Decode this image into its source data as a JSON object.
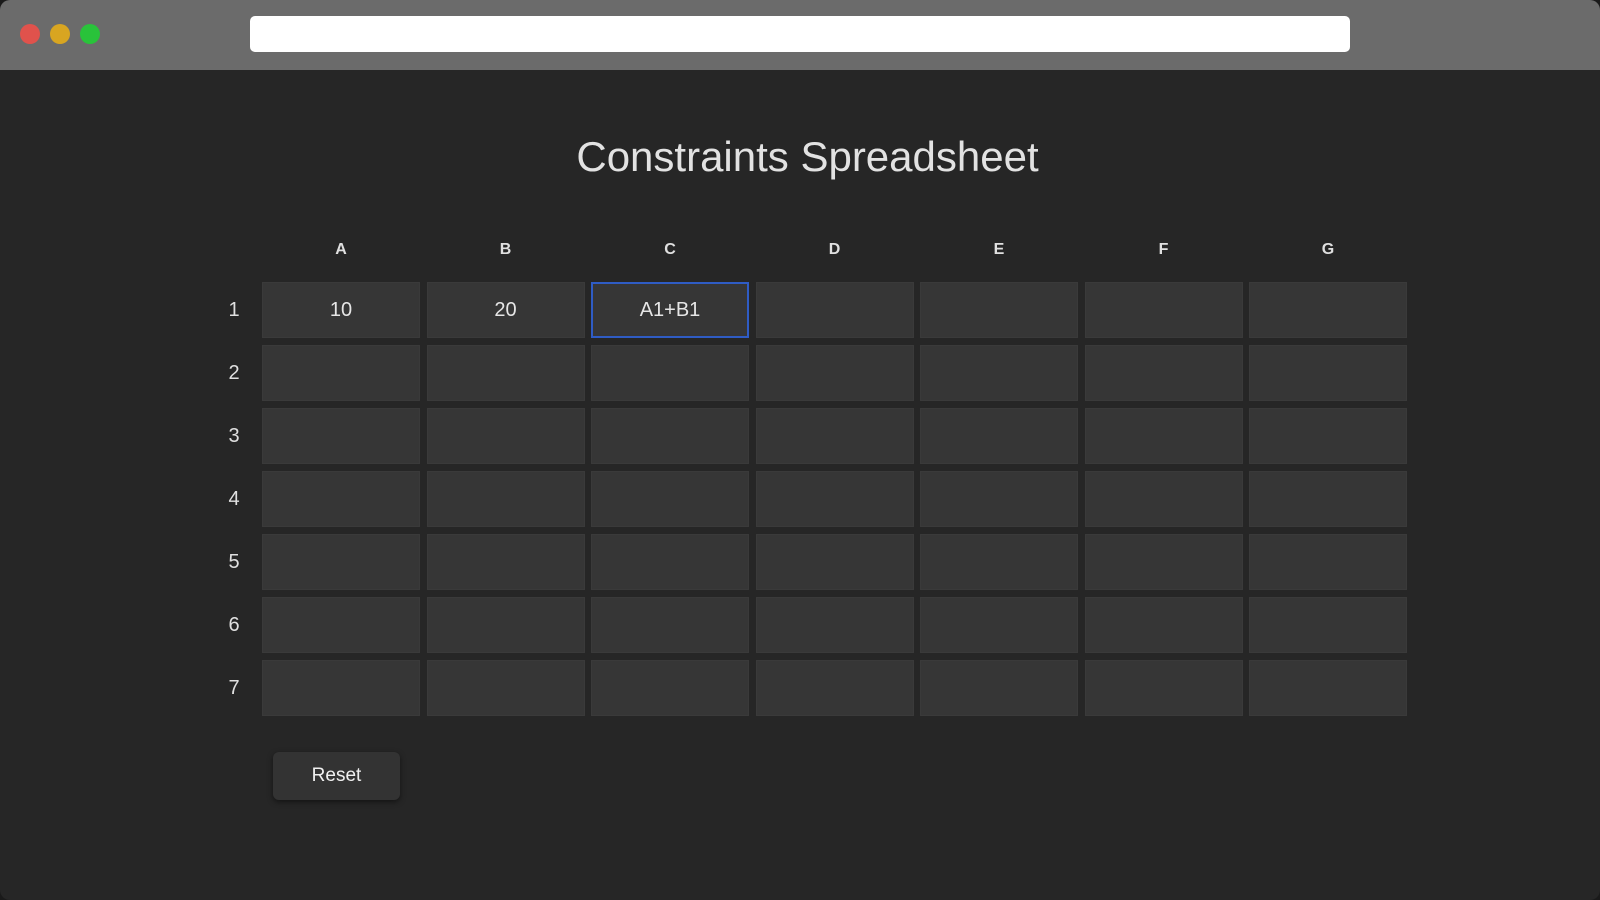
{
  "browser": {
    "url": ""
  },
  "page": {
    "title": "Constraints Spreadsheet"
  },
  "sheet": {
    "columns": [
      "A",
      "B",
      "C",
      "D",
      "E",
      "F",
      "G"
    ],
    "rows": [
      "1",
      "2",
      "3",
      "4",
      "5",
      "6",
      "7"
    ],
    "cells": [
      [
        "10",
        "20",
        "A1+B1",
        "",
        "",
        "",
        ""
      ],
      [
        "",
        "",
        "",
        "",
        "",
        "",
        ""
      ],
      [
        "",
        "",
        "",
        "",
        "",
        "",
        ""
      ],
      [
        "",
        "",
        "",
        "",
        "",
        "",
        ""
      ],
      [
        "",
        "",
        "",
        "",
        "",
        "",
        ""
      ],
      [
        "",
        "",
        "",
        "",
        "",
        "",
        ""
      ],
      [
        "",
        "",
        "",
        "",
        "",
        "",
        ""
      ]
    ],
    "selected_cell": "C1"
  },
  "actions": {
    "reset_label": "Reset"
  },
  "colors": {
    "background": "#262626",
    "titlebar": "#6b6b6b",
    "cell": "#363636",
    "selection": "#2f5cc4"
  }
}
